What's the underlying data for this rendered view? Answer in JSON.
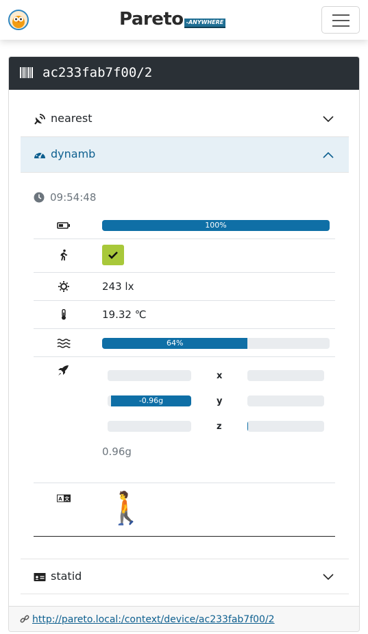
{
  "navbar": {
    "brand_main": "Pareto",
    "brand_tag": "-ANYWHERE"
  },
  "device": {
    "title": "ac233fab7f00/2"
  },
  "accordion": {
    "nearest": {
      "label": "nearest"
    },
    "dynamb": {
      "label": "dynamb"
    },
    "statid": {
      "label": "statid"
    }
  },
  "dynamb": {
    "time": "09:54:48",
    "battery": {
      "percent": 100,
      "label": "100%"
    },
    "motion": {
      "is_moving": true
    },
    "illuminance": "243 lx",
    "temperature": "19.32 ℃",
    "humidity": {
      "percent": 64,
      "label": "64%"
    },
    "acceleration": {
      "x": {
        "label": "x",
        "value": 0
      },
      "y": {
        "label": "y",
        "value": -0.96,
        "text": "-0.96g"
      },
      "z": {
        "label": "z",
        "value": 0.01
      },
      "magnitude": "0.96g"
    },
    "activity": {
      "emoji": "🚶"
    }
  },
  "footer": {
    "link": "http://pareto.local:/context/device/ac233fab7f00/2"
  },
  "colors": {
    "header_bg": "#2a3036",
    "accent": "#0f6fa6",
    "active_bg": "#e6f0f6",
    "check_green": "#a8c83a"
  }
}
